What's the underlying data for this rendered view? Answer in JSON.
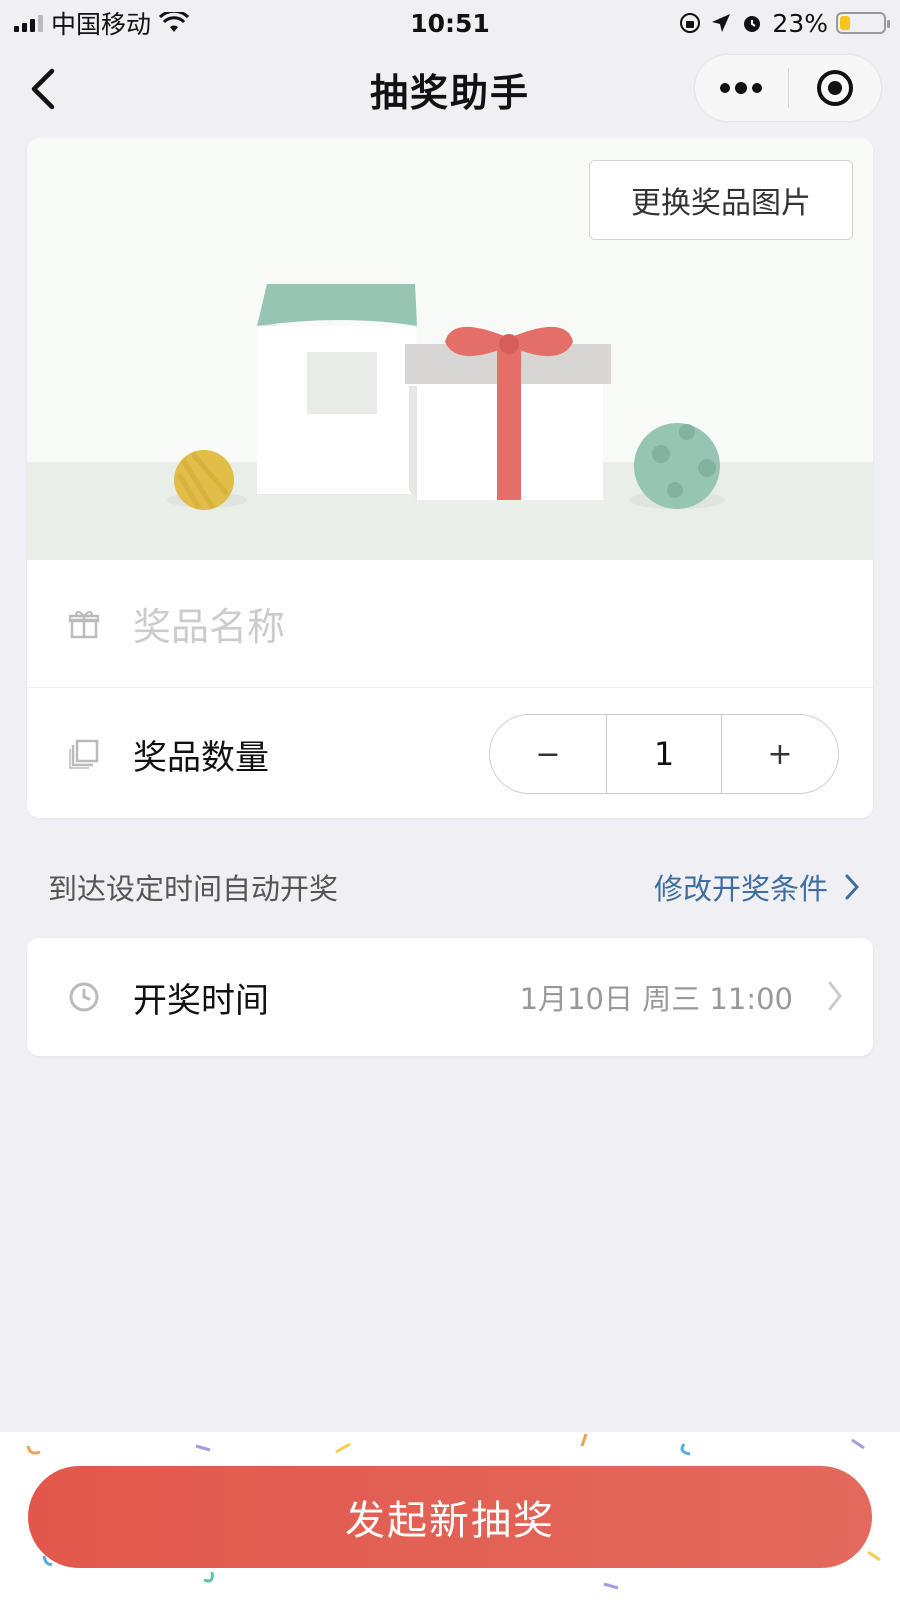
{
  "status_bar": {
    "carrier": "中国移动",
    "time": "10:51",
    "battery_percent": "23%",
    "battery_level": 0.23
  },
  "nav": {
    "title": "抽奖助手",
    "icons": [
      "back-arrow-icon",
      "more-icon",
      "target-icon"
    ]
  },
  "prize": {
    "change_image_label": "更换奖品图片",
    "name_placeholder": "奖品名称",
    "quantity_label": "奖品数量",
    "quantity_value": "1",
    "decrement_label": "−",
    "increment_label": "+"
  },
  "draw": {
    "hint": "到达设定时间自动开奖",
    "modify_label": "修改开奖条件",
    "time_label": "开奖时间",
    "time_value": "1月10日  周三  11:00"
  },
  "footer": {
    "start_button_label": "发起新抽奖"
  },
  "colors": {
    "accent_red": "#e2574c",
    "link_blue": "#3c6ea0",
    "mint_green": "#97c5b3",
    "battery_yellow": "#f5c518"
  }
}
